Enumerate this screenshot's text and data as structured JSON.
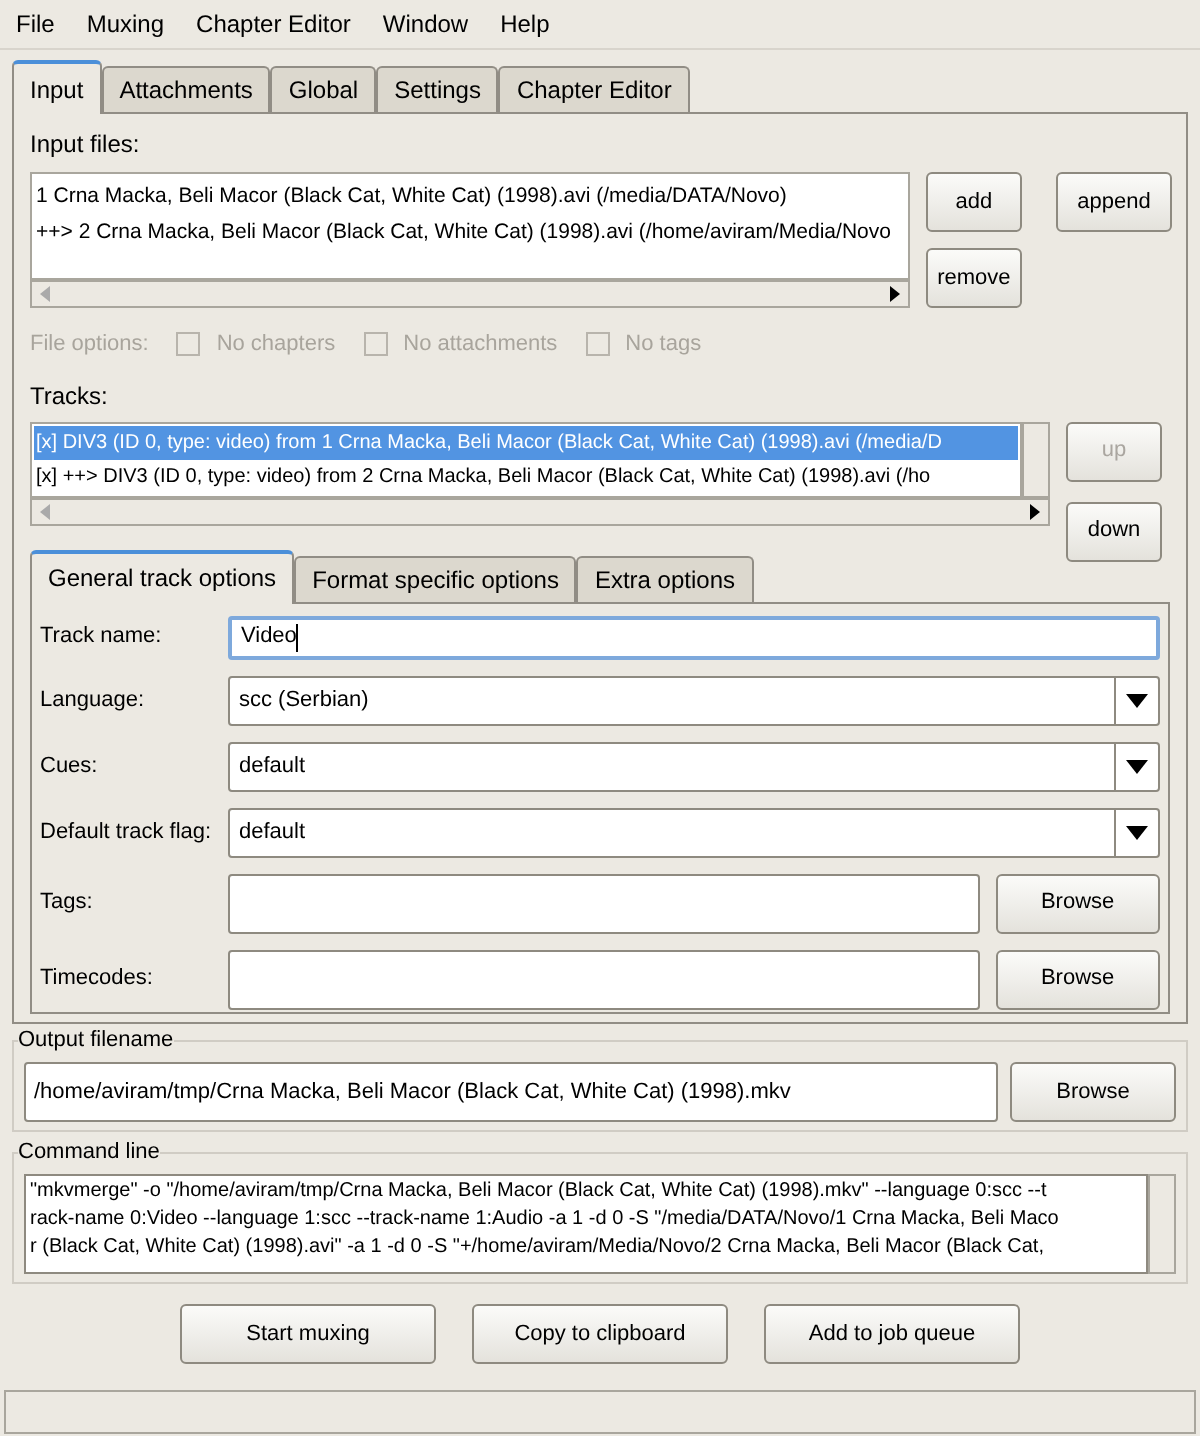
{
  "menu": [
    "File",
    "Muxing",
    "Chapter Editor",
    "Window",
    "Help"
  ],
  "tabs": [
    {
      "label": "Input",
      "selected": true
    },
    {
      "label": "Attachments",
      "selected": false
    },
    {
      "label": "Global",
      "selected": false
    },
    {
      "label": "Settings",
      "selected": false
    },
    {
      "label": "Chapter Editor",
      "selected": false
    }
  ],
  "input_files": {
    "label": "Input files:",
    "items": [
      "1 Crna Macka, Beli Macor (Black Cat, White Cat) (1998).avi (/media/DATA/Novo)",
      "++> 2 Crna Macka, Beli Macor (Black Cat, White Cat) (1998).avi (/home/aviram/Media/Novo"
    ],
    "buttons": [
      "add",
      "append",
      "remove"
    ]
  },
  "file_options": {
    "label": "File options:",
    "disabled": true,
    "options": [
      {
        "label": "No chapters",
        "checked": false
      },
      {
        "label": "No attachments",
        "checked": false
      },
      {
        "label": "No tags",
        "checked": false
      }
    ]
  },
  "tracks": {
    "label": "Tracks:",
    "items": [
      {
        "text": "[x] DIV3 (ID 0, type: video) from 1 Crna Macka, Beli Macor (Black Cat, White Cat) (1998).avi (/media/D",
        "selected": true
      },
      {
        "text": "[x] ++> DIV3 (ID 0, type: video) from 2 Crna Macka, Beli Macor (Black Cat, White Cat) (1998).avi (/ho",
        "selected": false
      }
    ],
    "buttons": [
      {
        "label": "up",
        "disabled": true
      },
      {
        "label": "down",
        "disabled": false
      }
    ]
  },
  "track_tabs": [
    {
      "label": "General track options",
      "selected": true
    },
    {
      "label": "Format specific options",
      "selected": false
    },
    {
      "label": "Extra options",
      "selected": false
    }
  ],
  "fields": [
    {
      "kind": "text",
      "label": "Track name:",
      "value": "Video"
    },
    {
      "kind": "select",
      "label": "Language:",
      "value": "scc (Serbian)"
    },
    {
      "kind": "select",
      "label": "Cues:",
      "value": "default"
    },
    {
      "kind": "select",
      "label": "Default track flag:",
      "value": "default"
    },
    {
      "kind": "browse",
      "label": "Tags:",
      "button": "Browse"
    },
    {
      "kind": "browse",
      "label": "Timecodes:",
      "button": "Browse"
    }
  ],
  "output": {
    "title": "Output filename",
    "value": "/home/aviram/tmp/Crna Macka, Beli Macor (Black Cat, White Cat) (1998).mkv",
    "button": "Browse"
  },
  "command_line": {
    "title": "Command line",
    "lines": [
      "\"mkvmerge\" -o \"/home/aviram/tmp/Crna Macka, Beli Macor (Black Cat, White Cat) (1998).mkv\"  --language 0:scc --t",
      "rack-name 0:Video --language 1:scc --track-name 1:Audio -a 1 -d 0 -S \"/media/DATA/Novo/1 Crna Macka, Beli Maco",
      "r (Black Cat, White Cat) (1998).avi\" -a 1 -d 0 -S \"+/home/aviram/Media/Novo/2 Crna Macka, Beli Macor (Black Cat,"
    ]
  },
  "actions": [
    "Start muxing",
    "Copy to clipboard",
    "Add to job queue"
  ]
}
